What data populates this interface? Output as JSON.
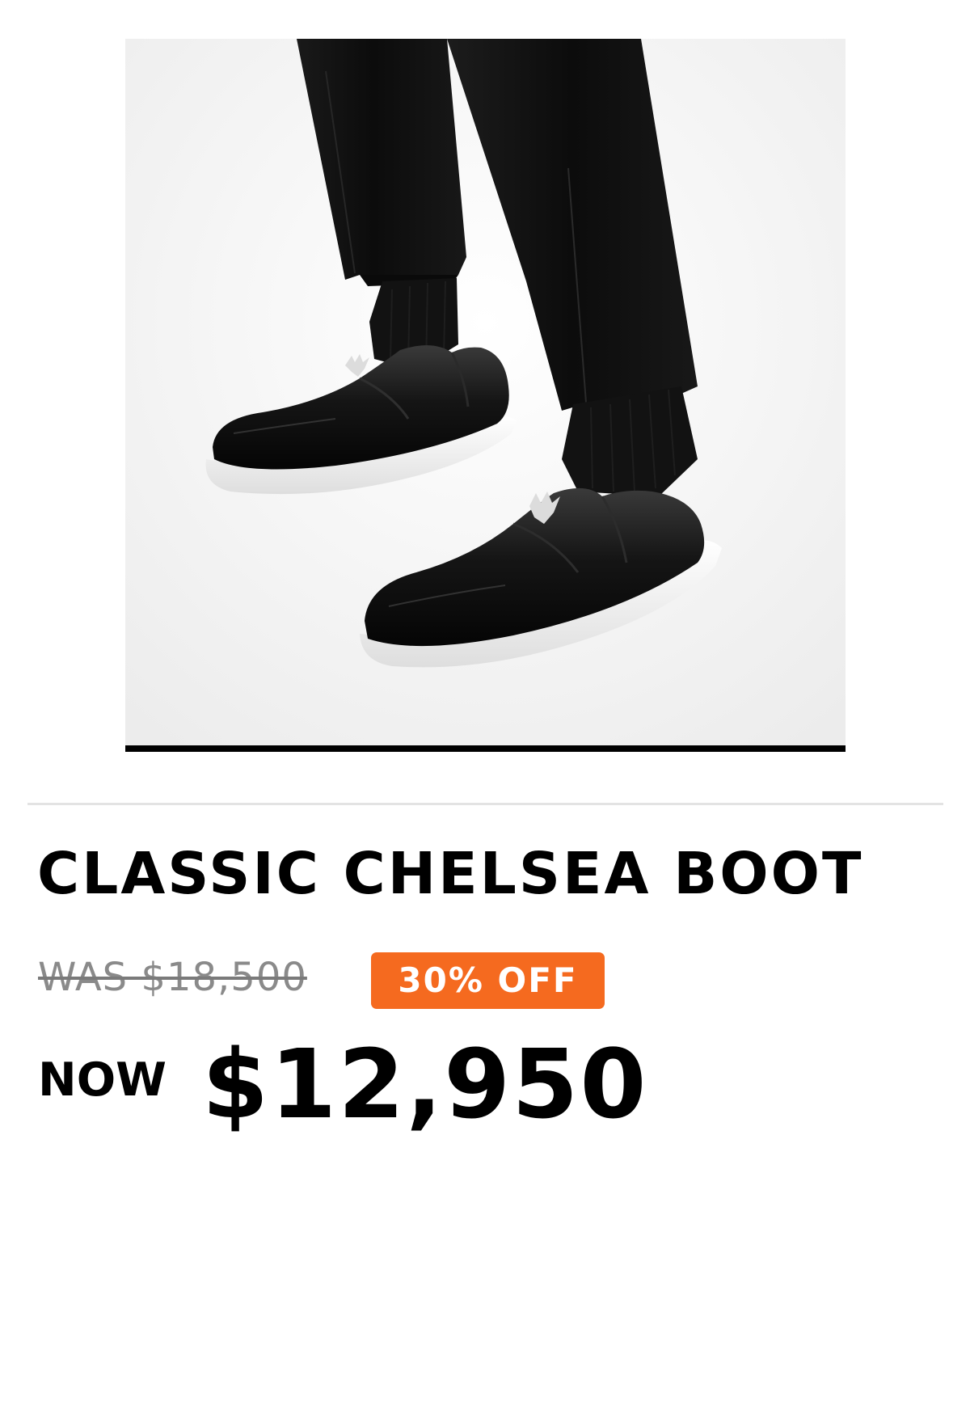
{
  "product": {
    "title": "CLASSIC CHELSEA BOOT",
    "image_icon": "black-slip-on-shoes-photo"
  },
  "pricing": {
    "was_price": "WAS $18,500",
    "discount_badge": "30% OFF",
    "now_label": "NOW",
    "now_price": "$12,950"
  },
  "colors": {
    "badge": "#f56a1f",
    "title": "#000000",
    "was_price": "#8a8a8a"
  }
}
